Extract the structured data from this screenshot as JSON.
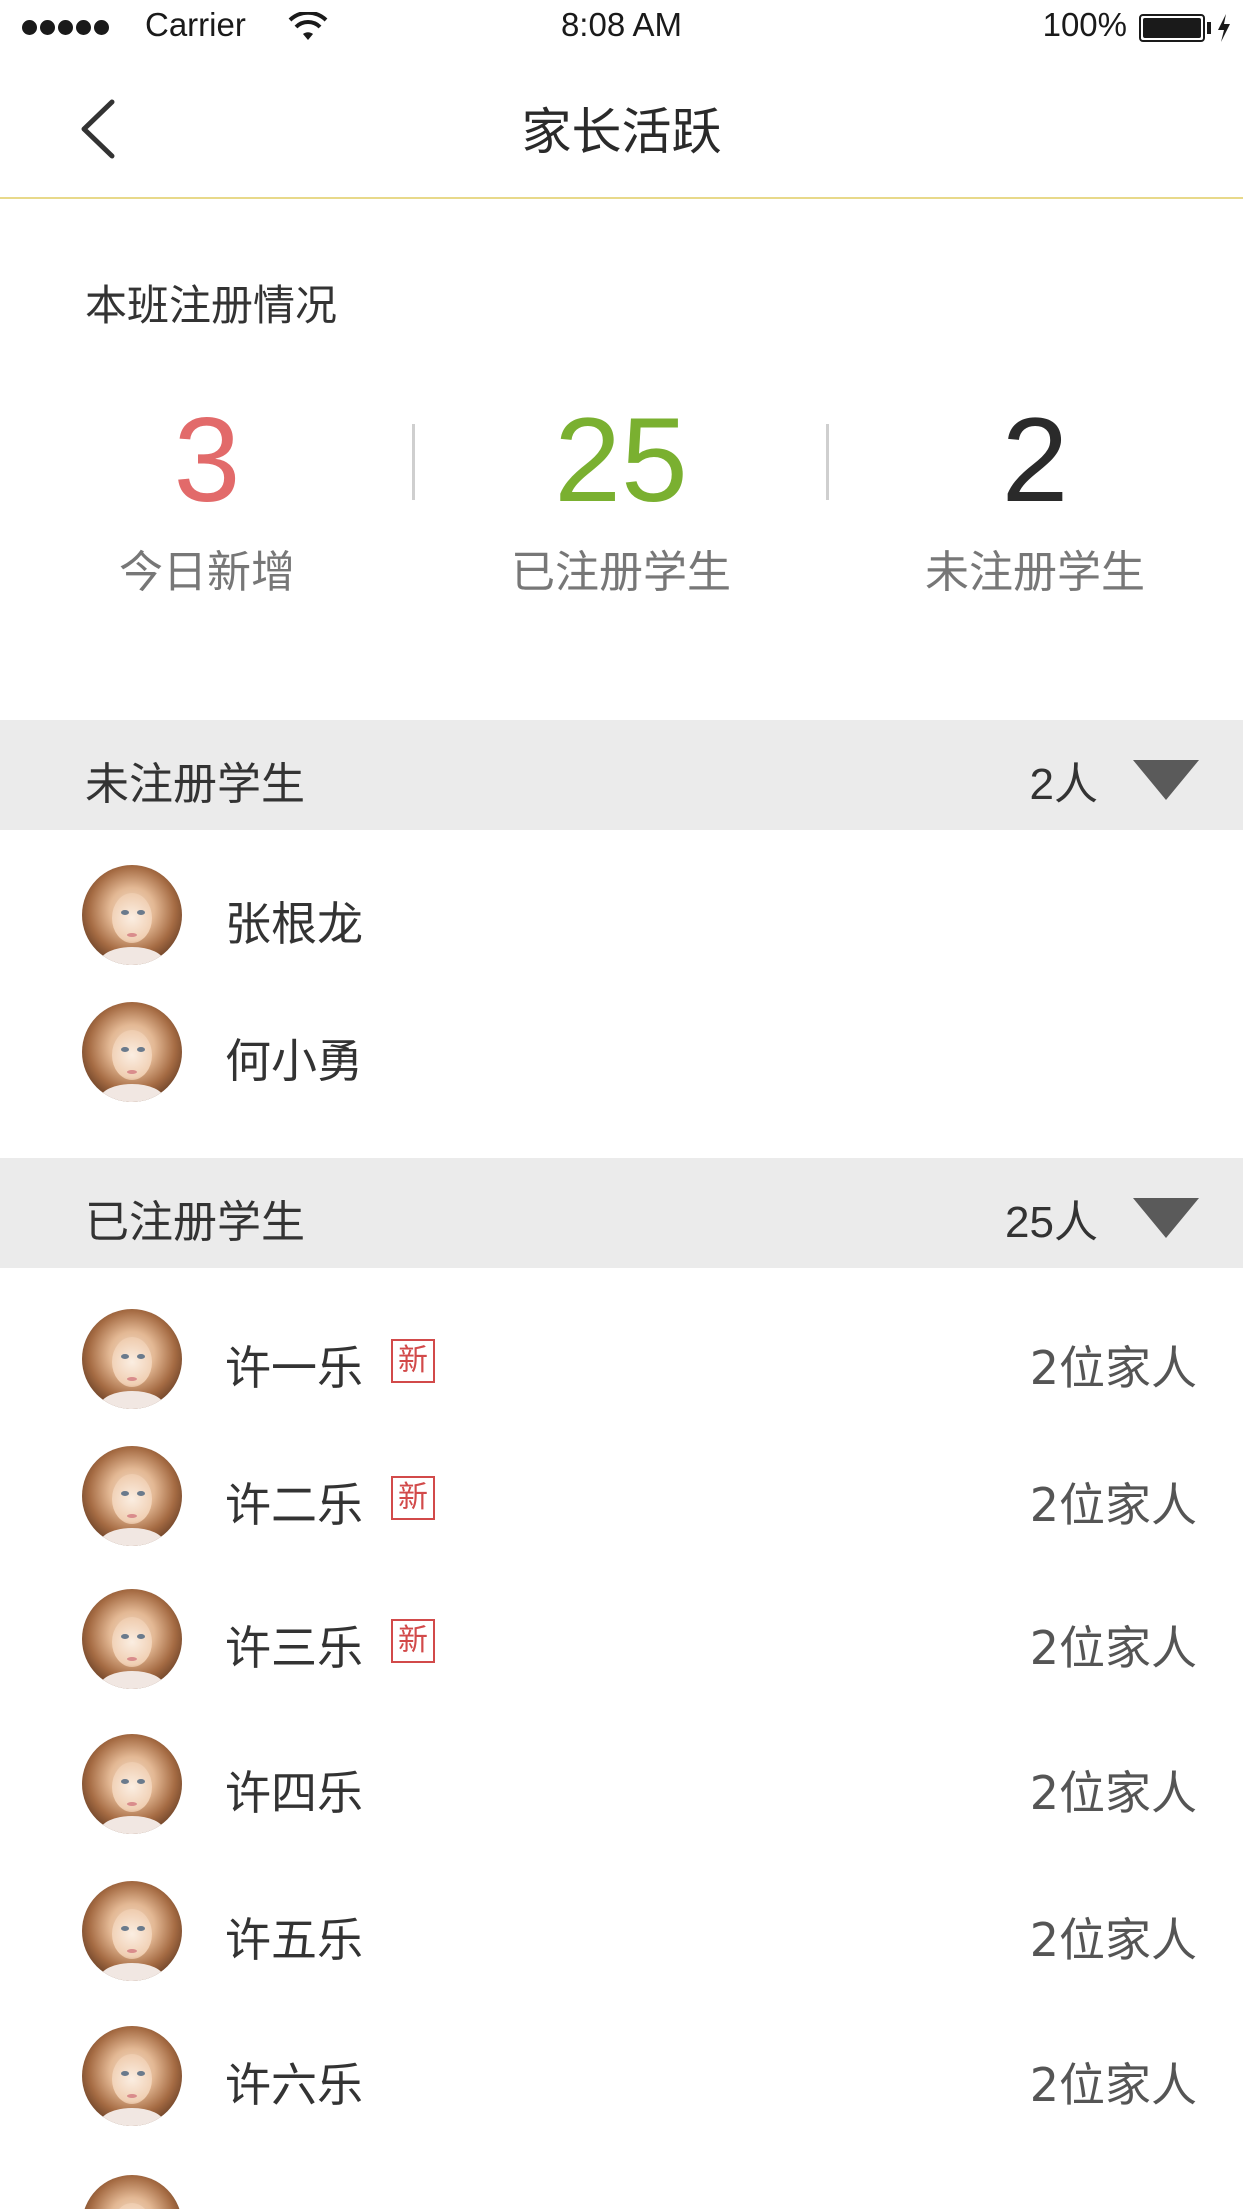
{
  "status_bar": {
    "carrier": "Carrier",
    "time": "8:08 AM",
    "battery": "100%"
  },
  "nav": {
    "title": "家长活跃"
  },
  "summary": {
    "title": "本班注册情况",
    "stats": [
      {
        "value": "3",
        "label": "今日新增",
        "color": "#e26a6a"
      },
      {
        "value": "25",
        "label": "已注册学生",
        "color": "#7ab030"
      },
      {
        "value": "2",
        "label": "未注册学生",
        "color": "#2a2a2a"
      }
    ]
  },
  "unregistered": {
    "title": "未注册学生",
    "count": "2人",
    "students": [
      {
        "name": "张根龙"
      },
      {
        "name": "何小勇"
      }
    ]
  },
  "registered": {
    "title": "已注册学生",
    "count": "25人",
    "badge_text": "新",
    "students": [
      {
        "name": "许一乐",
        "new": true,
        "family": "2位家人"
      },
      {
        "name": "许二乐",
        "new": true,
        "family": "2位家人"
      },
      {
        "name": "许三乐",
        "new": true,
        "family": "2位家人"
      },
      {
        "name": "许四乐",
        "new": false,
        "family": "2位家人"
      },
      {
        "name": "许五乐",
        "new": false,
        "family": "2位家人"
      },
      {
        "name": "许六乐",
        "new": false,
        "family": "2位家人"
      }
    ]
  }
}
